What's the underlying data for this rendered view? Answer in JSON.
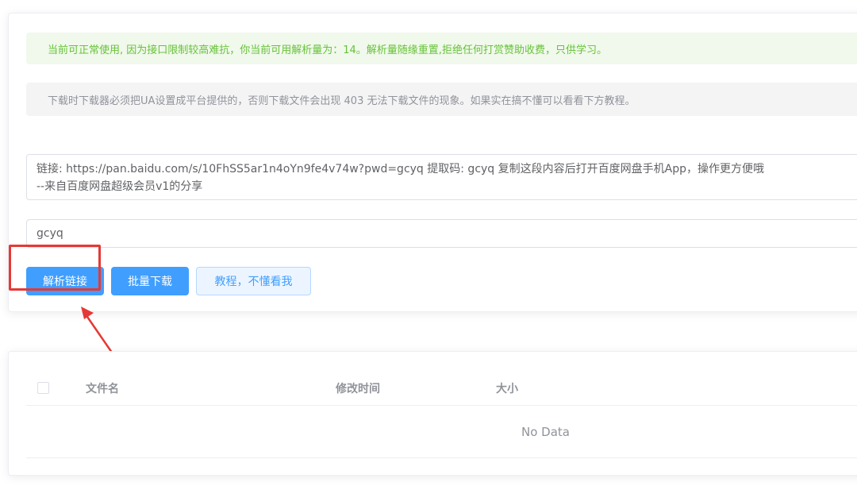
{
  "notices": {
    "success": "当前可正常使用, 因为接口限制较高难抗，你当前可用解析量为：14。解析量随缘重置,拒绝任何打赏赞助收费，只供学习。",
    "info": "下载时下载器必须把UA设置成平台提供的，否则下载文件会出现 403 无法下载文件的现象。如果实在搞不懂可以看看下方教程。"
  },
  "form": {
    "link_text": "链接: https://pan.baidu.com/s/10FhSS5ar1n4oYn9fe4v74w?pwd=gcyq 提取码: gcyq 复制这段内容后打开百度网盘手机App，操作更方便哦\n--来自百度网盘超级会员v1的分享",
    "password": "gcyq"
  },
  "buttons": {
    "parse": "解析链接",
    "batch_download": "批量下载",
    "tutorial": "教程，不懂看我"
  },
  "table": {
    "columns": [
      "文件名",
      "修改时间",
      "大小"
    ],
    "empty_text": "No Data"
  },
  "colors": {
    "primary": "#409eff",
    "success": "#67c23a",
    "annotation": "#e53935"
  }
}
